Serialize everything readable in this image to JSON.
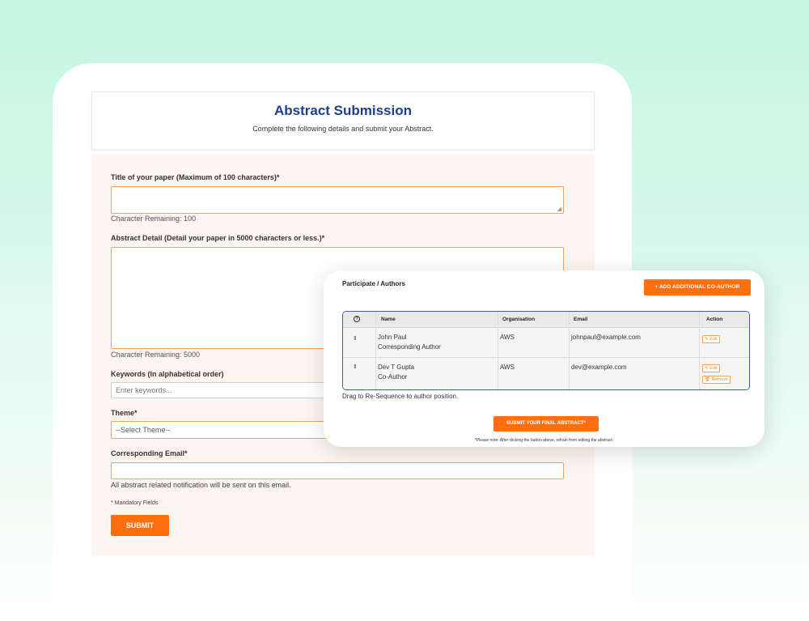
{
  "header": {
    "title": "Abstract Submission",
    "subtitle": "Complete the following details and submit your Abstract."
  },
  "form": {
    "title_label": "Title of your paper (Maximum of 100 characters)*",
    "title_value": "",
    "title_remaining": "Character Remaining: 100",
    "abstract_label": "Abstract Detail (Detail your paper in 5000 characters or less.)*",
    "abstract_value": "",
    "abstract_remaining": "Character Remaining: 5000",
    "keywords_label": "Keywords (In alphabetical order)",
    "keywords_placeholder": "Enter keywords...",
    "theme_label": "Theme*",
    "theme_selected": "--Select Theme--",
    "email_label": "Corresponding Email*",
    "email_value": "",
    "email_note": "All abstract related notification will be sent on this email.",
    "mandatory_note": "* Mandatory Fields",
    "submit_label": "SUBMIT"
  },
  "authors": {
    "title": "Participate / Authors",
    "add_button": "+ ADD ADDITIONAL CO-AUTHOR",
    "columns": {
      "help": "?",
      "name": "Name",
      "organisation": "Organisation",
      "email": "Email",
      "action": "Action"
    },
    "rows": [
      {
        "sort": "⇕",
        "name": "John Paul",
        "role": "Corresponding Author",
        "organisation": "AWS",
        "email": "johnpaul@example.com",
        "edit": "Edit"
      },
      {
        "sort": "⇕",
        "name": "Dev T Gupta",
        "role": "Co-Author",
        "organisation": "AWS",
        "email": "dev@example.com",
        "edit": "Edit",
        "remove": "Remove"
      }
    ],
    "drag_note": "Drag to Re-Sequence to author position.",
    "final_button": "SUBMIT YOUR FINAL ABSTRACT*",
    "final_note": "*Please note: After clicking the button above, refrain from editing the abstract."
  },
  "colors": {
    "accent": "#ff6f0f",
    "title": "#1d3f8f",
    "table_border": "#3b5fa8"
  }
}
